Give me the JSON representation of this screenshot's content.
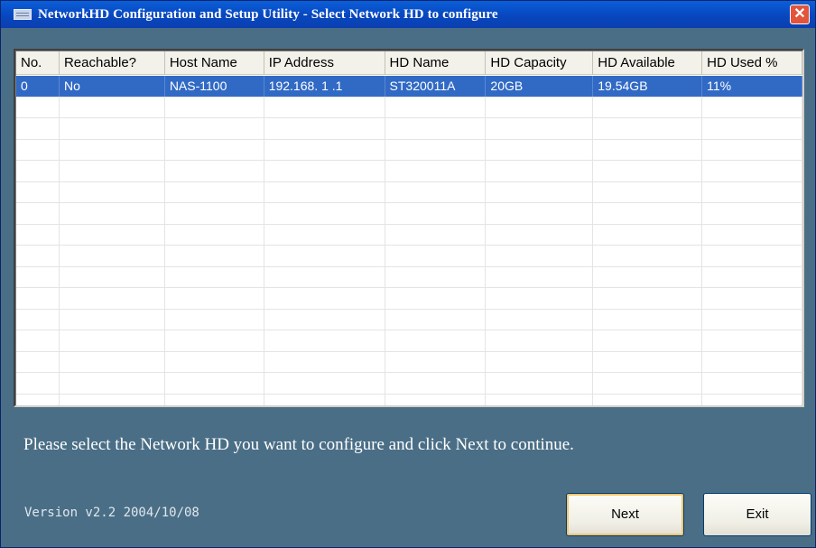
{
  "window": {
    "title": "NetworkHD Configuration and Setup Utility - Select Network HD to configure",
    "close_label": "✕"
  },
  "table": {
    "columns": [
      "No.",
      "Reachable?",
      "Host Name",
      "IP Address",
      "HD Name",
      "HD Capacity",
      "HD Available",
      "HD Used %"
    ],
    "rows": [
      [
        "0",
        "No",
        "NAS-1100",
        "192.168. 1 .1",
        "ST320011A",
        "20GB",
        "19.54GB",
        "11%"
      ]
    ],
    "selected_row": 0
  },
  "instruction": "Please select the Network HD you want to configure and click Next to continue.",
  "version": "Version v2.2  2004/10/08",
  "buttons": {
    "next_label": "Next",
    "exit_label": "Exit"
  },
  "colors": {
    "title_bar": "#0a50cc",
    "panel": "#4a6e86",
    "selection": "#316ac5"
  }
}
